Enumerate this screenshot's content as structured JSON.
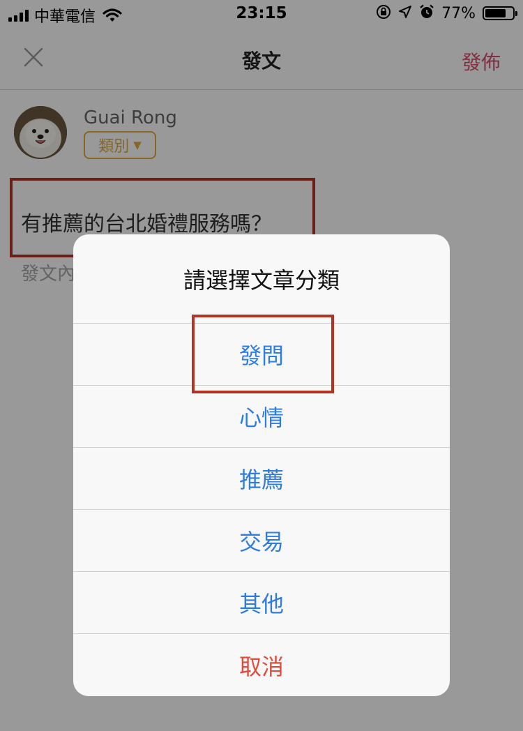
{
  "status_bar": {
    "carrier": "中華電信",
    "time": "23:15",
    "battery_pct": "77%",
    "battery_level": 0.77,
    "icons": [
      "signal-icon",
      "wifi-icon",
      "orientation-lock-icon",
      "location-icon",
      "alarm-icon",
      "battery-icon"
    ]
  },
  "nav": {
    "title": "發文",
    "publish_label": "發佈",
    "close_icon": "close-icon"
  },
  "author": {
    "name": "Guai Rong",
    "category_label": "類別",
    "category_caret": "▼"
  },
  "post": {
    "title": "有推薦的台北婚禮服務嗎？",
    "content_placeholder": "發文內"
  },
  "category_sheet": {
    "title": "請選擇文章分類",
    "options": [
      {
        "label": "發問"
      },
      {
        "label": "心情"
      },
      {
        "label": "推薦"
      },
      {
        "label": "交易"
      },
      {
        "label": "其他"
      }
    ],
    "cancel_label": "取消"
  },
  "colors": {
    "accent_pink": "#d64d6e",
    "category_gold": "#e3a83a",
    "option_blue": "#2f7ce0",
    "cancel_red": "#e54a39",
    "highlight_red": "#b43424"
  }
}
